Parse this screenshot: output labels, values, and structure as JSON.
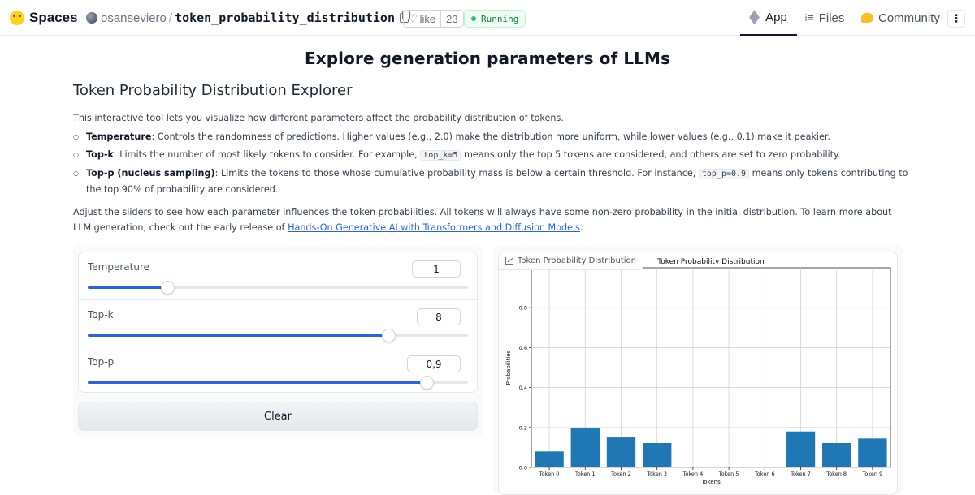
{
  "header": {
    "brand": "Spaces",
    "owner": "osanseviero",
    "separator": "/",
    "repo": "token_probability_distribution",
    "like_label": "like",
    "like_count": "23",
    "status": "Running",
    "nav": {
      "app": "App",
      "files": "Files",
      "community": "Community"
    },
    "menu_glyph": "⋮"
  },
  "content": {
    "main_title": "Explore generation parameters of LLMs",
    "sub_title": "Token Probability Distribution Explorer",
    "intro": "This interactive tool lets you visualize how different parameters affect the probability distribution of tokens.",
    "bullets": [
      {
        "term": "Temperature",
        "text_before": ": Controls the randomness of predictions. Higher values (e.g., 2.0) make the distribution more uniform, while lower values (e.g., 0.1) make it peakier.",
        "code": "",
        "text_after": ""
      },
      {
        "term": "Top-k",
        "text_before": ": Limits the number of most likely tokens to consider. For example, ",
        "code": "top_k=5",
        "text_after": " means only the top 5 tokens are considered, and others are set to zero probability."
      },
      {
        "term": "Top-p (nucleus sampling)",
        "text_before": ": Limits the tokens to those whose cumulative probability mass is below a certain threshold. For instance, ",
        "code": "top_p=0.9",
        "text_after": " means only tokens contributing to the top 90% of probability are considered."
      }
    ],
    "outro_before": "Adjust the sliders to see how each parameter influences the token probabilities. All tokens will always have some non-zero probability in the initial distribution. To learn more about LLM generation, check out the early release of ",
    "outro_link": "Hands-On Generative AI with Transformers and Diffusion Models",
    "outro_after": "."
  },
  "controls": {
    "temperature": {
      "label": "Temperature",
      "value": "1",
      "fraction": 0.21
    },
    "top_k": {
      "label": "Top-k",
      "value": "8",
      "fraction": 0.79
    },
    "top_p": {
      "label": "Top-p",
      "value": "0,9",
      "fraction": 0.89
    },
    "clear_label": "Clear"
  },
  "plot": {
    "tab_label": "Token Probability Distribution"
  },
  "chart_data": {
    "type": "bar",
    "title": "Token Probability Distribution",
    "xlabel": "Tokens",
    "ylabel": "Probabilities",
    "categories": [
      "Token 0",
      "Token 1",
      "Token 2",
      "Token 3",
      "Token 4",
      "Token 5",
      "Token 6",
      "Token 7",
      "Token 8",
      "Token 9"
    ],
    "values": [
      0.08,
      0.195,
      0.15,
      0.122,
      0.0,
      0.0,
      0.0,
      0.18,
      0.122,
      0.145
    ],
    "ylim": [
      0,
      1.0
    ],
    "yticks": [
      0.0,
      0.2,
      0.4,
      0.6,
      0.8
    ],
    "grid": true,
    "bar_color": "#1f77b4"
  }
}
